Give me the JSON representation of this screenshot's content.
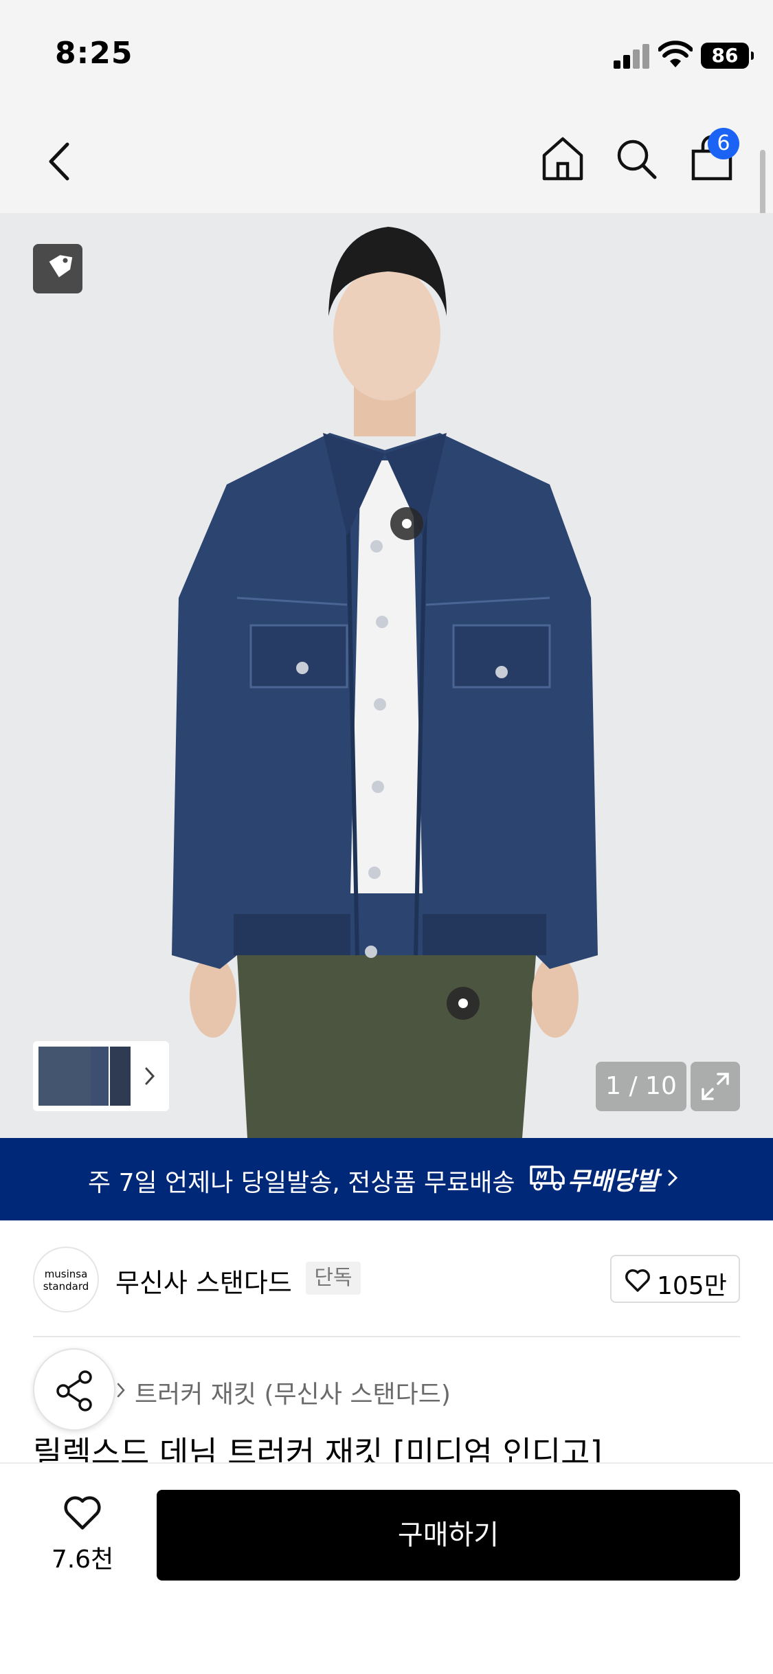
{
  "status_bar": {
    "time": "8:25",
    "battery": "86"
  },
  "nav": {
    "cart_count": "6"
  },
  "gallery": {
    "pager": "1 / 10"
  },
  "banner": {
    "text": "주 7일 언제나 당일발송, 전상품 무료배송",
    "label": "무배당발"
  },
  "brand": {
    "logo_line1": "musinsa",
    "logo_line2": "standard",
    "name": "무신사 스탠다드",
    "badge": "단독",
    "likes": "105만"
  },
  "product": {
    "category": "트러커 재킷 (무신사 스탠다드)",
    "title": "릴렉스드 데님 트러커 재킷 [미디엄 인디고]"
  },
  "bottom": {
    "wish_count": "7.6천",
    "buy_label": "구매하기"
  },
  "colors": {
    "banner_bg": "#002879",
    "badge_blue": "#1a63f5",
    "denim": "#2c4470",
    "pants": "#4b5540"
  }
}
